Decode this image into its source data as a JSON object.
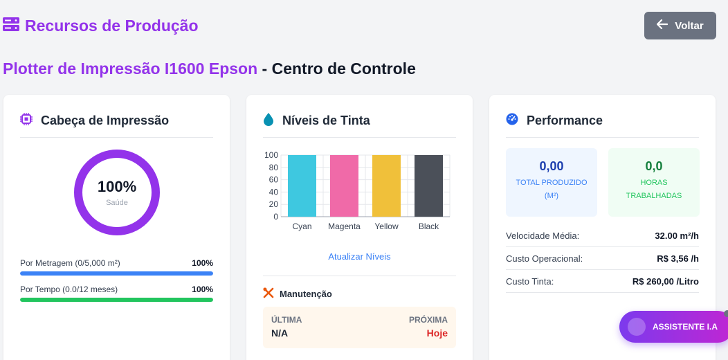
{
  "header": {
    "app_title": "Recursos de Produção",
    "back_label": "Voltar"
  },
  "page": {
    "device_name": "Plotter de Impressão I1600 Epson",
    "separator": "- Centro de Controle"
  },
  "print_head": {
    "title": "Cabeça de Impressão",
    "health_value": "100%",
    "health_fraction": 1.0,
    "health_label": "Saúde",
    "bars": [
      {
        "label": "Por Metragem (0/5,000 m²)",
        "pct": "100%",
        "fraction": 1.0,
        "color": "#3b82f6"
      },
      {
        "label": "Por Tempo (0.0/12 meses)",
        "pct": "100%",
        "fraction": 1.0,
        "color": "#22c55e"
      }
    ]
  },
  "ink": {
    "title": "Níveis de Tinta",
    "update_label": "Atualizar Níveis",
    "maintenance": {
      "title": "Manutenção",
      "last_label": "ÚLTIMA",
      "last_value": "N/A",
      "next_label": "PRÓXIMA",
      "next_value": "Hoje"
    }
  },
  "chart_data": {
    "type": "bar",
    "categories": [
      "Cyan",
      "Magenta",
      "Yellow",
      "Black"
    ],
    "values": [
      100,
      100,
      100,
      100
    ],
    "colors": [
      "#3ec8e0",
      "#f06aa8",
      "#f0c03a",
      "#4b5059"
    ],
    "ylim": [
      0,
      100
    ],
    "yticks": [
      0,
      20,
      40,
      60,
      80,
      100
    ],
    "grid": true
  },
  "performance": {
    "title": "Performance",
    "total_value": "0,00",
    "total_label_1": "TOTAL PRODUZIDO",
    "total_label_2": "(M²)",
    "hours_value": "0,0",
    "hours_label_1": "HORAS",
    "hours_label_2": "TRABALHADAS",
    "rows": [
      {
        "key": "Velocidade Média:",
        "value": "32.00 m²/h"
      },
      {
        "key": "Custo Operacional:",
        "value": "R$ 3,56 /h"
      },
      {
        "key": "Custo Tinta:",
        "value": "R$ 260,00 /Litro"
      }
    ]
  },
  "assistant": {
    "label": "ASSISTENTE I.A"
  },
  "colors": {
    "accent": "#9333ea",
    "back_button": "#6b7280",
    "ring": "#9333ea"
  }
}
